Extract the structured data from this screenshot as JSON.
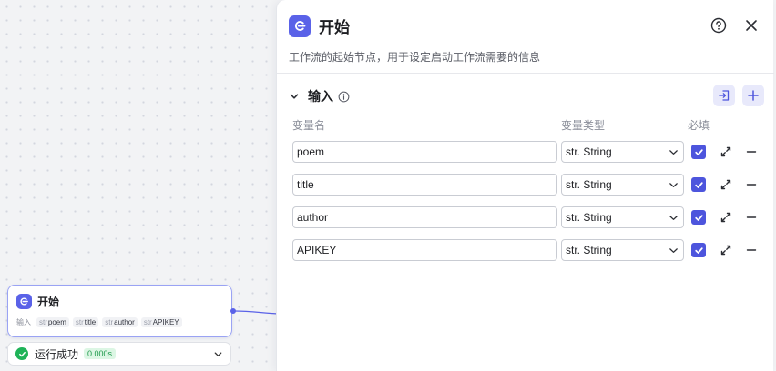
{
  "node": {
    "title": "开始",
    "inputs_label": "输入",
    "vars": [
      {
        "type": "str",
        "name": "poem"
      },
      {
        "type": "str",
        "name": "title"
      },
      {
        "type": "str",
        "name": "author"
      },
      {
        "type": "str",
        "name": "APIKEY"
      }
    ],
    "accent_color": "#5a62e8"
  },
  "run_status": {
    "label": "运行成功",
    "duration": "0.000s",
    "status_color": "#1fb358"
  },
  "panel": {
    "title": "开始",
    "description": "工作流的起始节点，用于设定启动工作流需要的信息",
    "icons": [
      "start-icon",
      "help-icon",
      "close-icon"
    ]
  },
  "inputs_section": {
    "title": "输入",
    "columns": {
      "name": "变量名",
      "type": "变量类型",
      "required": "必填"
    },
    "rows": [
      {
        "name": "poem",
        "type": "str. String",
        "required": true
      },
      {
        "name": "title",
        "type": "str. String",
        "required": true
      },
      {
        "name": "author",
        "type": "str. String",
        "required": true
      },
      {
        "name": "APIKEY",
        "type": "str. String",
        "required": true
      }
    ]
  }
}
